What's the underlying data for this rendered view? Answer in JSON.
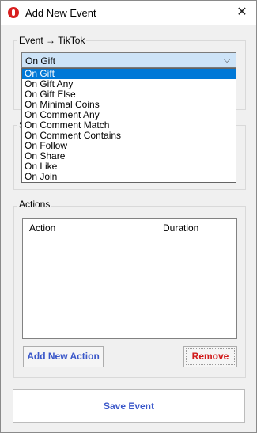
{
  "window": {
    "title": "Add New Event",
    "app_icon": "app-logo-icon",
    "close_glyph": "✕"
  },
  "event_group": {
    "legend": "Event → TikTok",
    "select": {
      "value": "On Gift",
      "chevron_glyph": "⌵"
    },
    "dropdown_options": [
      "On Gift",
      "On Gift Any",
      "On Gift Else",
      "On Minimal Coins",
      "On Comment Any",
      "On Comment Match",
      "On Comment Contains",
      "On Follow",
      "On Share",
      "On Like",
      "On Join"
    ],
    "selected_index": 0
  },
  "partial_group_label": "S",
  "actions_group": {
    "legend": "Actions",
    "columns": [
      "Action",
      "Duration"
    ],
    "add_button": "Add New Action",
    "remove_button": "Remove"
  },
  "save_button": "Save Event",
  "colors": {
    "selection": "#0078d7",
    "accent_blue": "#3a57c9",
    "danger_red": "#d11a1a"
  }
}
